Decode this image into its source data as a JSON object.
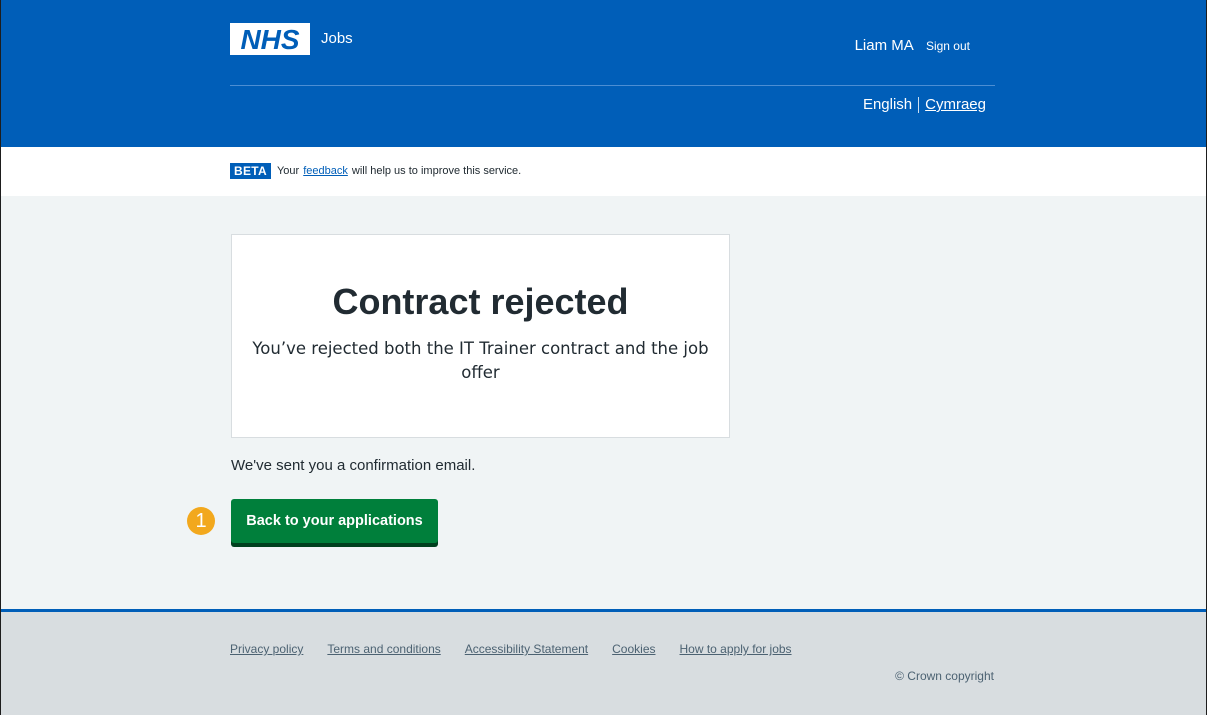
{
  "header": {
    "logo_text": "NHS",
    "service_name": "Jobs",
    "user_name": "Liam MA",
    "sign_out": "Sign out",
    "lang_current": "English",
    "lang_other": "Cymraeg"
  },
  "beta": {
    "tag": "BETA",
    "text_before": "Your",
    "link": "feedback",
    "text_after": "will help us to improve this service."
  },
  "main": {
    "heading": "Contract rejected",
    "body": "You’ve rejected both the IT Trainer contract and the job offer",
    "confirmation": "We've sent you a confirmation email.",
    "button_label": "Back to your applications",
    "step_number": "1"
  },
  "footer": {
    "links": [
      "Privacy policy",
      "Terms and conditions",
      "Accessibility Statement",
      "Cookies",
      "How to apply for jobs"
    ],
    "copyright": "© Crown copyright"
  },
  "colors": {
    "nhs_blue": "#005eb8",
    "button_green": "#007f3b",
    "badge_orange": "#f2a81d",
    "page_background": "#f0f4f5",
    "footer_background": "#d8dde0"
  }
}
